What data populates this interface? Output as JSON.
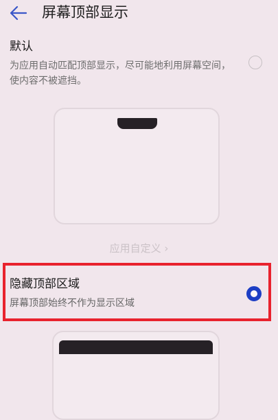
{
  "header": {
    "title": "屏幕顶部显示"
  },
  "options": {
    "default": {
      "title": "默认",
      "description": "为应用自动匹配顶部显示，尽可能地利用屏幕空间，使内容不被遮挡。",
      "selected": false
    },
    "custom_link": "应用自定义 ›",
    "hide": {
      "title": "隐藏顶部区域",
      "description": "屏幕顶部始终不作为显示区域",
      "selected": true
    }
  },
  "icons": {
    "back": "back-arrow-icon"
  },
  "colors": {
    "accent": "#1d3ec4",
    "highlight": "#e8222d",
    "background": "#f1e6ec"
  }
}
